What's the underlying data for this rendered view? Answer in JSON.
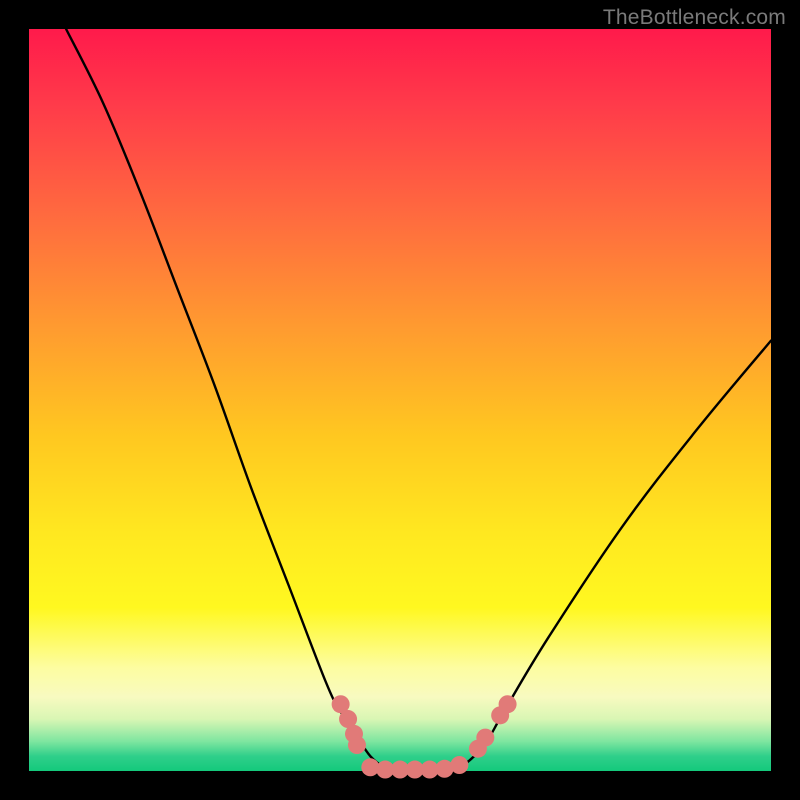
{
  "watermark": {
    "text": "TheBottleneck.com"
  },
  "colors": {
    "background": "#000000",
    "curve_stroke": "#000000",
    "marker_fill": "#e17a78",
    "watermark": "#7a7a7a"
  },
  "chart_data": {
    "type": "line",
    "title": "",
    "xlabel": "",
    "ylabel": "",
    "xlim": [
      0,
      100
    ],
    "ylim": [
      0,
      100
    ],
    "grid": false,
    "legend": false,
    "series": [
      {
        "name": "curve",
        "x": [
          5,
          10,
          15,
          20,
          25,
          30,
          35,
          40,
          42,
          44,
          46,
          48,
          50,
          52,
          54,
          56,
          58,
          60,
          62,
          64,
          70,
          80,
          90,
          100
        ],
        "y": [
          100,
          90,
          78,
          65,
          52,
          38,
          25,
          12,
          8,
          5,
          2,
          0.5,
          0,
          0,
          0,
          0,
          0.5,
          2,
          4.5,
          8,
          18,
          33,
          46,
          58
        ]
      }
    ],
    "markers": [
      {
        "x": 42.0,
        "y": 9.0
      },
      {
        "x": 43.0,
        "y": 7.0
      },
      {
        "x": 43.8,
        "y": 5.0
      },
      {
        "x": 44.2,
        "y": 3.5
      },
      {
        "x": 46.0,
        "y": 0.5
      },
      {
        "x": 48.0,
        "y": 0.2
      },
      {
        "x": 50.0,
        "y": 0.2
      },
      {
        "x": 52.0,
        "y": 0.2
      },
      {
        "x": 54.0,
        "y": 0.2
      },
      {
        "x": 56.0,
        "y": 0.3
      },
      {
        "x": 58.0,
        "y": 0.8
      },
      {
        "x": 60.5,
        "y": 3.0
      },
      {
        "x": 61.5,
        "y": 4.5
      },
      {
        "x": 63.5,
        "y": 7.5
      },
      {
        "x": 64.5,
        "y": 9.0
      }
    ]
  }
}
